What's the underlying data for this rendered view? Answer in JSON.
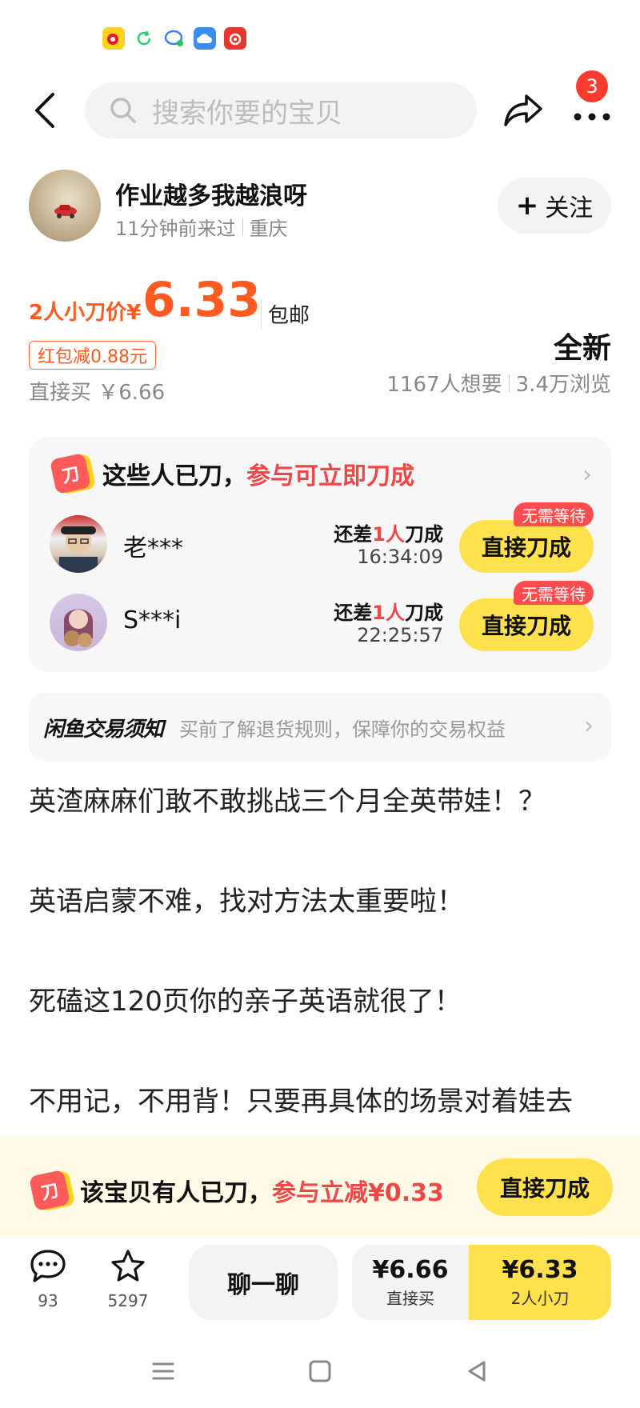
{
  "search": {
    "placeholder": "搜索你要的宝贝"
  },
  "cart_badge": "3",
  "seller": {
    "name": "作业越多我越浪呀",
    "last_seen": "11分钟前来过",
    "location": "重庆",
    "follow_label": "关注"
  },
  "price": {
    "label": "2人小刀价¥",
    "value": "6.33",
    "shipping": "包邮",
    "red_packet": "红包减0.88元",
    "direct_buy": "直接买 ￥6.66",
    "condition": "全新",
    "wants": "1167人想要",
    "views": "3.4万浏览"
  },
  "group": {
    "title": "这些人已刀，",
    "title_red": "参与可立即刀成",
    "badge": "刀",
    "members": [
      {
        "name": "老***",
        "need_prefix": "还差",
        "need_count": "1人",
        "need_suffix": "刀成",
        "time": "16:34:09",
        "tag": "无需等待",
        "button": "直接刀成"
      },
      {
        "name": "S***i",
        "need_prefix": "还差",
        "need_count": "1人",
        "need_suffix": "刀成",
        "time": "22:25:57",
        "tag": "无需等待",
        "button": "直接刀成"
      }
    ]
  },
  "notice": {
    "title": "闲鱼交易须知",
    "text": "买前了解退货规则，保障你的交易权益"
  },
  "description": [
    "英渣麻麻们敢不敢挑战三个月全英带娃！？",
    "英语启蒙不难，找对方法太重要啦！",
    "死磕这120页你的亲子英语就很了！",
    "不用记，不用背！只要再具体的场景对着娃去"
  ],
  "bottom_banner": {
    "text": "该宝贝有人已刀，",
    "text_red": "参与立减¥0.33",
    "button": "直接刀成"
  },
  "actions": {
    "comments": "93",
    "favorites": "5297",
    "chat": "聊一聊",
    "direct_price": "¥6.66",
    "direct_label": "直接买",
    "group_price": "¥6.33",
    "group_label": "2人小刀"
  },
  "colors": {
    "accent": "#ff5a1f",
    "yellow": "#ffe14d",
    "red": "#f04646"
  }
}
